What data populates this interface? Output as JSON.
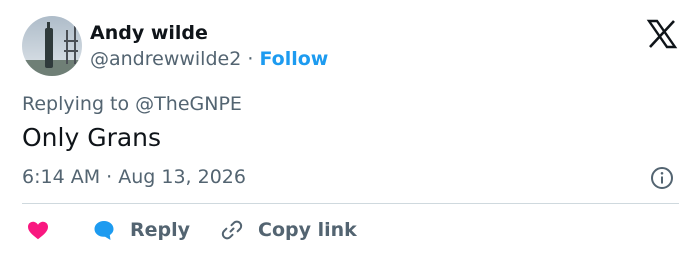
{
  "author": {
    "name": "Andy wilde",
    "handle": "@andrewwilde2",
    "separator": "·",
    "follow_label": "Follow",
    "avatar_icon": "avatar-photo"
  },
  "brand_icon": "x-logo-icon",
  "reply_context": {
    "prefix": "Replying to",
    "target": "@TheGNPE"
  },
  "tweet": {
    "text": "Only Grans",
    "timestamp": "6:14 AM · Aug 13, 2026"
  },
  "actions": {
    "like_icon": "heart-icon",
    "reply_icon": "speech-bubble-icon",
    "reply_label": "Reply",
    "copy_icon": "link-icon",
    "copy_label": "Copy link"
  },
  "colors": {
    "accent": "#1d9bf0",
    "like": "#f91880",
    "text_primary": "#0f1419",
    "text_secondary": "#536471",
    "divider": "#cfd9de"
  }
}
